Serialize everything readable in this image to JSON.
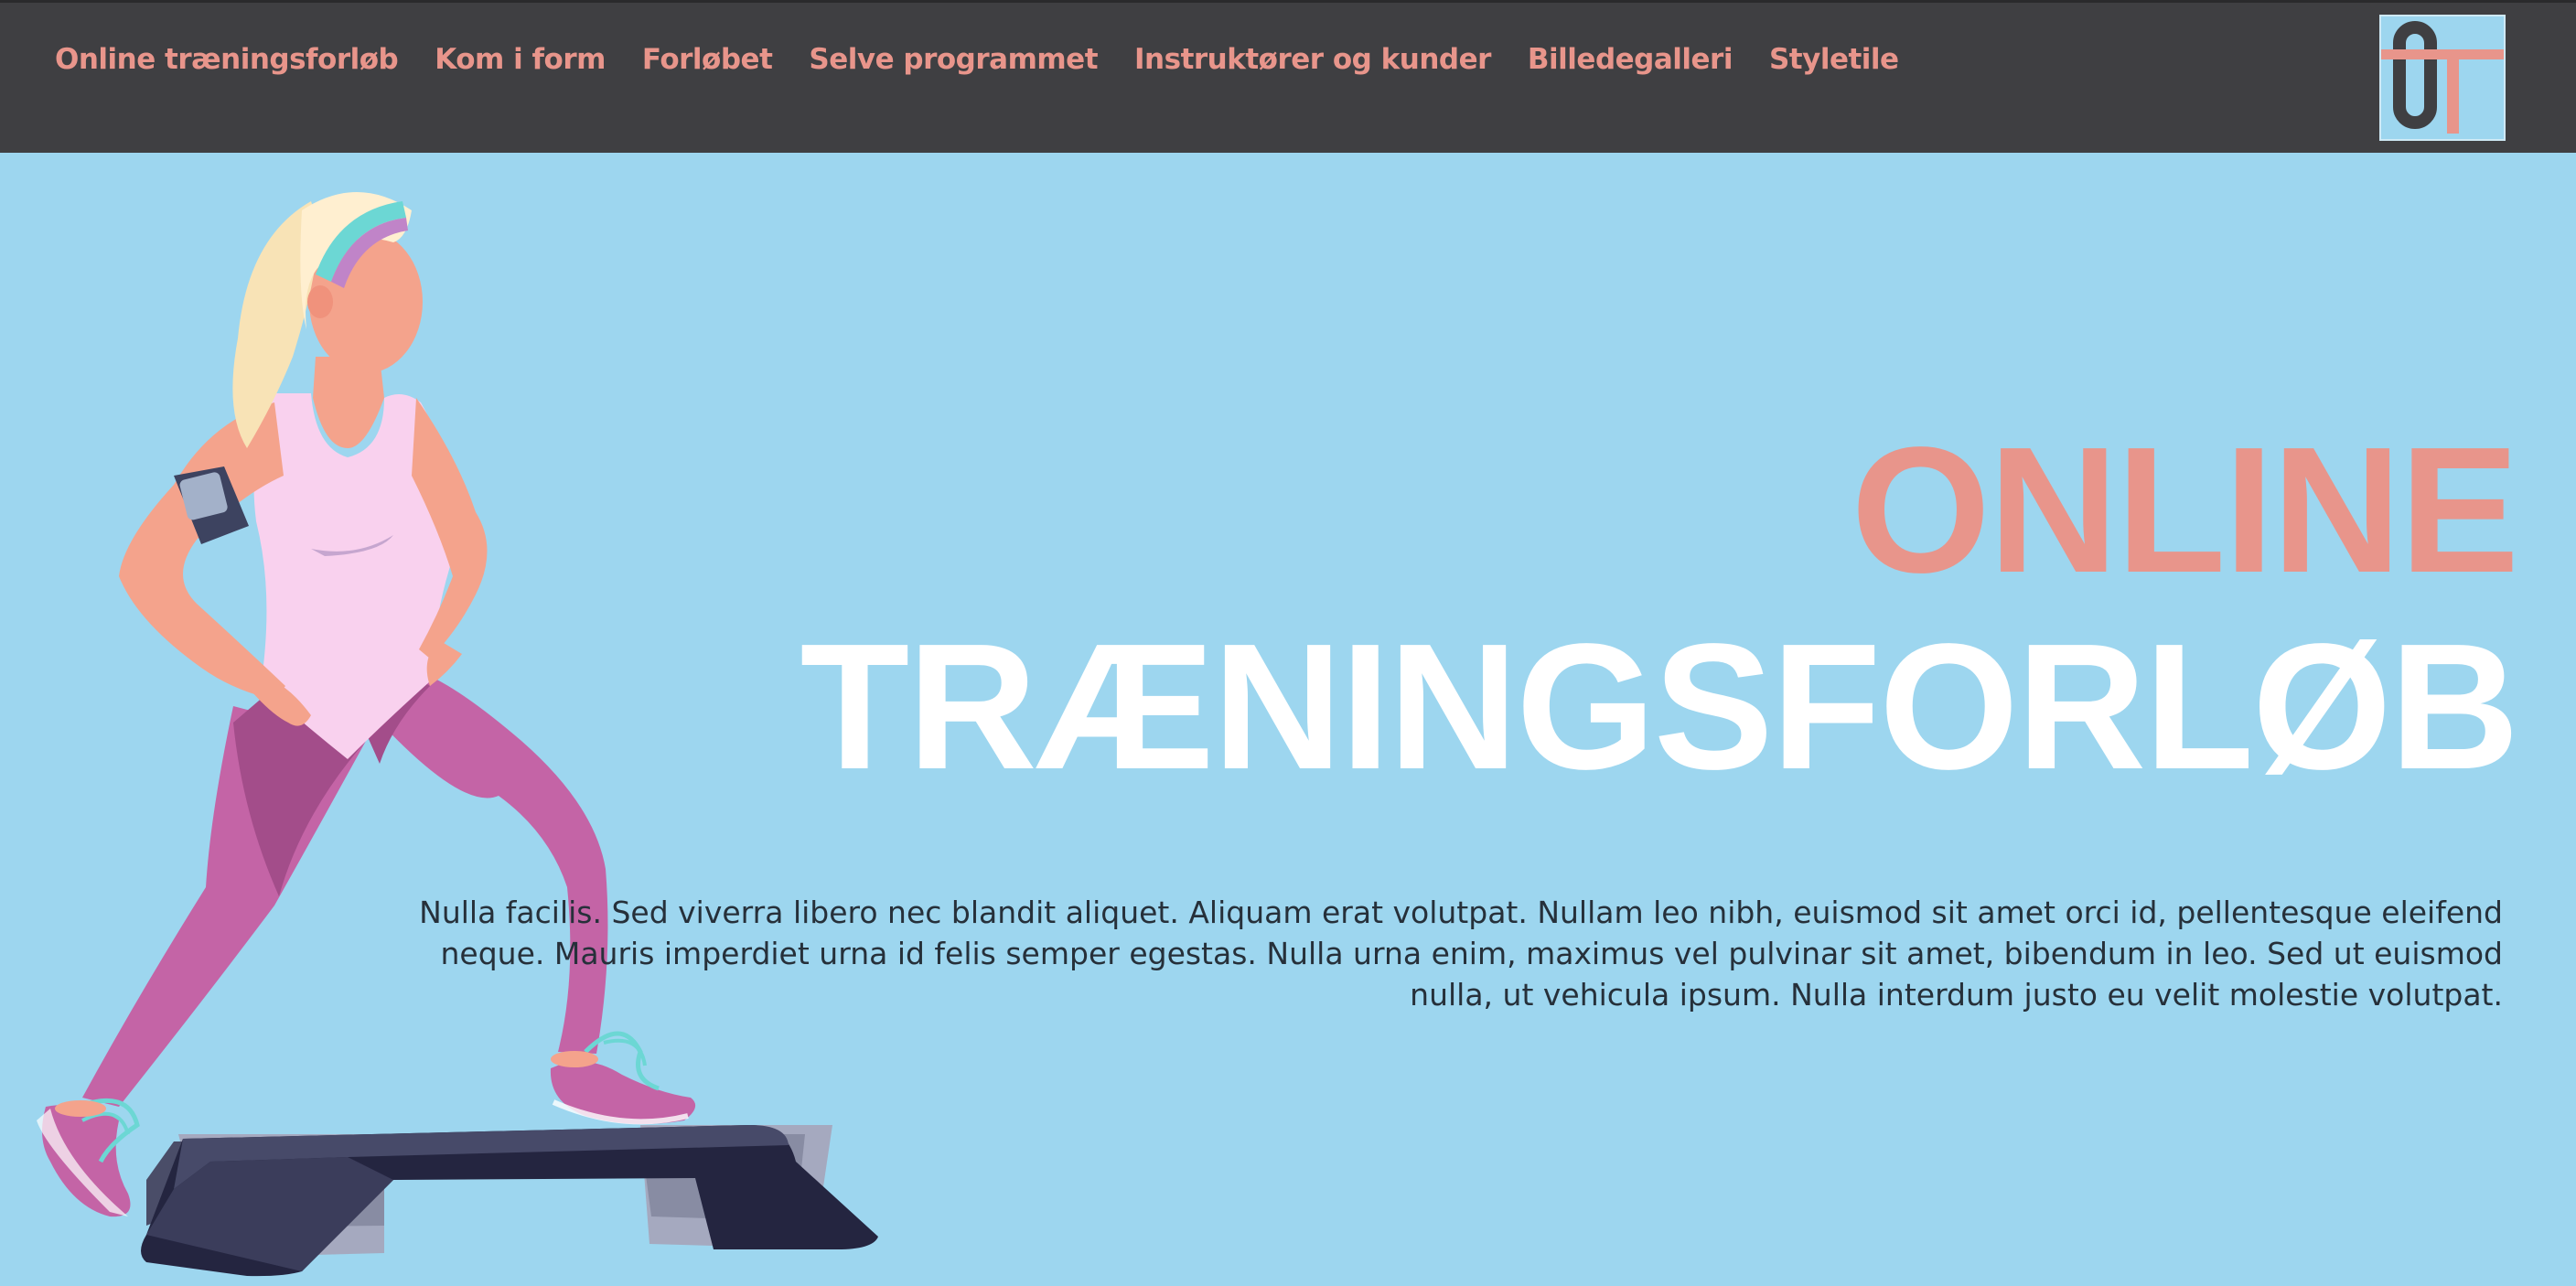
{
  "nav": {
    "items": [
      {
        "label": "Online træningsforløb"
      },
      {
        "label": "Kom i form"
      },
      {
        "label": "Forløbet"
      },
      {
        "label": "Selve programmet"
      },
      {
        "label": "Instruktører og kunder"
      },
      {
        "label": "Billedegalleri"
      },
      {
        "label": "Styletile"
      }
    ]
  },
  "logo": {
    "letters": "OT"
  },
  "hero": {
    "title_line1": "ONLINE",
    "title_line2": "TRÆNINGSFORLØB",
    "body": "Nulla facilis. Sed viverra libero nec blandit aliquet. Aliquam erat volutpat. Nullam leo nibh, euismod sit amet orci id, pellentesque eleifend neque. Mauris imperdiet urna id felis semper egestas. Nulla urna enim, maximus vel pulvinar sit amet, bibendum in leo. Sed ut euismod nulla, ut vehicula ipsum. Nulla interdum justo eu velit molestie volutpat."
  },
  "colors": {
    "background": "#9dd6ef",
    "topbar": "#3f3f42",
    "accent": "#e8958b",
    "title_white": "#ffffff",
    "body_text": "#26303a"
  }
}
